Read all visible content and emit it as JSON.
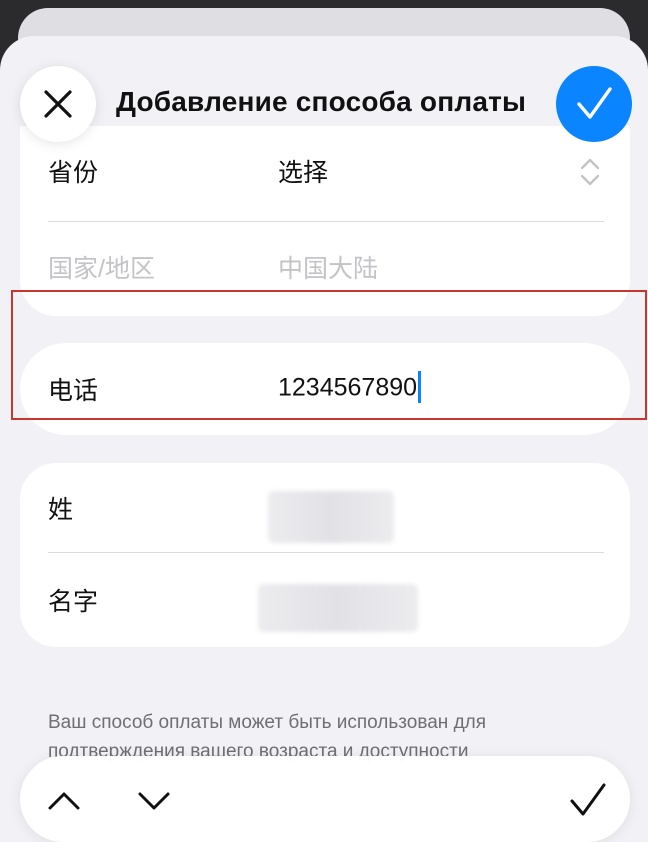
{
  "header": {
    "title": "Добавление способа оплаты",
    "close_icon": "close-icon",
    "confirm_icon": "checkmark-icon",
    "accent_color": "#0a84ff"
  },
  "address": {
    "province_label": "省份",
    "province_value": "选择",
    "country_label": "国家/地区",
    "country_value": "中国大陆"
  },
  "phone": {
    "label": "电话",
    "value": "1234567890",
    "highlight_color": "#c8372d"
  },
  "name": {
    "last_name_label": "姓",
    "first_name_label": "名字"
  },
  "footnote": {
    "text": "Ваш способ оплаты может быть использован для подтверждения вашего возраста и доступности"
  },
  "toolbar": {
    "prev_icon": "chevron-up-icon",
    "next_icon": "chevron-down-icon",
    "done_icon": "checkmark-icon"
  }
}
